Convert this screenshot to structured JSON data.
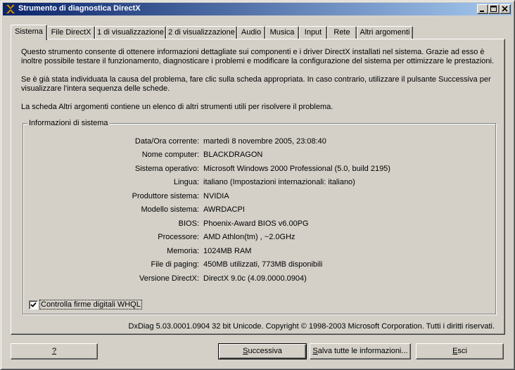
{
  "window": {
    "title": "Strumento di diagnostica DirectX"
  },
  "tabs": [
    {
      "label": "Sistema",
      "active": true
    },
    {
      "label": "File DirectX"
    },
    {
      "label": "1 di visualizzazione"
    },
    {
      "label": "2 di visualizzazione"
    },
    {
      "label": "Audio"
    },
    {
      "label": "Musica"
    },
    {
      "label": "Input"
    },
    {
      "label": "Rete"
    },
    {
      "label": "Altri argomenti"
    }
  ],
  "intro": {
    "p1": "Questo strumento consente di ottenere informazioni dettagliate sui componenti e i driver DirectX installati nel sistema. Grazie ad esso è inoltre possibile testare il funzionamento, diagnosticare i problemi e modificare la configurazione del sistema per ottimizzare le prestazioni.",
    "p2": "Se è già stata individuata la causa del problema, fare clic sulla scheda appropriata. In caso contrario, utilizzare il pulsante Successiva per visualizzare l'intera sequenza delle schede.",
    "p3": "La scheda Altri argomenti contiene un elenco di altri strumenti utili per risolvere il problema."
  },
  "system_info": {
    "legend": "Informazioni di sistema",
    "rows": [
      {
        "label": "Data/Ora corrente:",
        "value": "martedì 8 novembre 2005, 23:08:40"
      },
      {
        "label": "Nome computer:",
        "value": "BLACKDRAGON"
      },
      {
        "label": "Sistema operativo:",
        "value": "Microsoft Windows 2000 Professional (5.0, build 2195)"
      },
      {
        "label": "Lingua:",
        "value": "italiano (Impostazioni internazionali: italiano)"
      },
      {
        "label": "Produttore sistema:",
        "value": "NVIDIA"
      },
      {
        "label": "Modello sistema:",
        "value": "AWRDACPI"
      },
      {
        "label": "BIOS:",
        "value": "Phoenix-Award BIOS v6.00PG"
      },
      {
        "label": "Processore:",
        "value": "AMD Athlon(tm) , ~2.0GHz"
      },
      {
        "label": "Memoria:",
        "value": "1024MB RAM"
      },
      {
        "label": "File di paging:",
        "value": "450MB utilizzati, 773MB disponibili"
      },
      {
        "label": "Versione DirectX:",
        "value": "DirectX 9.0c (4.09.0000.0904)"
      }
    ],
    "checkbox_label": "Controlla firme digitali WHQL",
    "checkbox_checked": true
  },
  "footer": "DxDiag 5.03.0001.0904 32 bit Unicode. Copyright © 1998-2003 Microsoft Corporation. Tutti i diritti riservati.",
  "buttons": {
    "help": "?",
    "next_prefix": "",
    "next_accel": "S",
    "next_rest": "uccessiva",
    "save_accel": "S",
    "save_rest": "alva tutte le informazioni...",
    "exit_accel": "E",
    "exit_rest": "sci"
  }
}
